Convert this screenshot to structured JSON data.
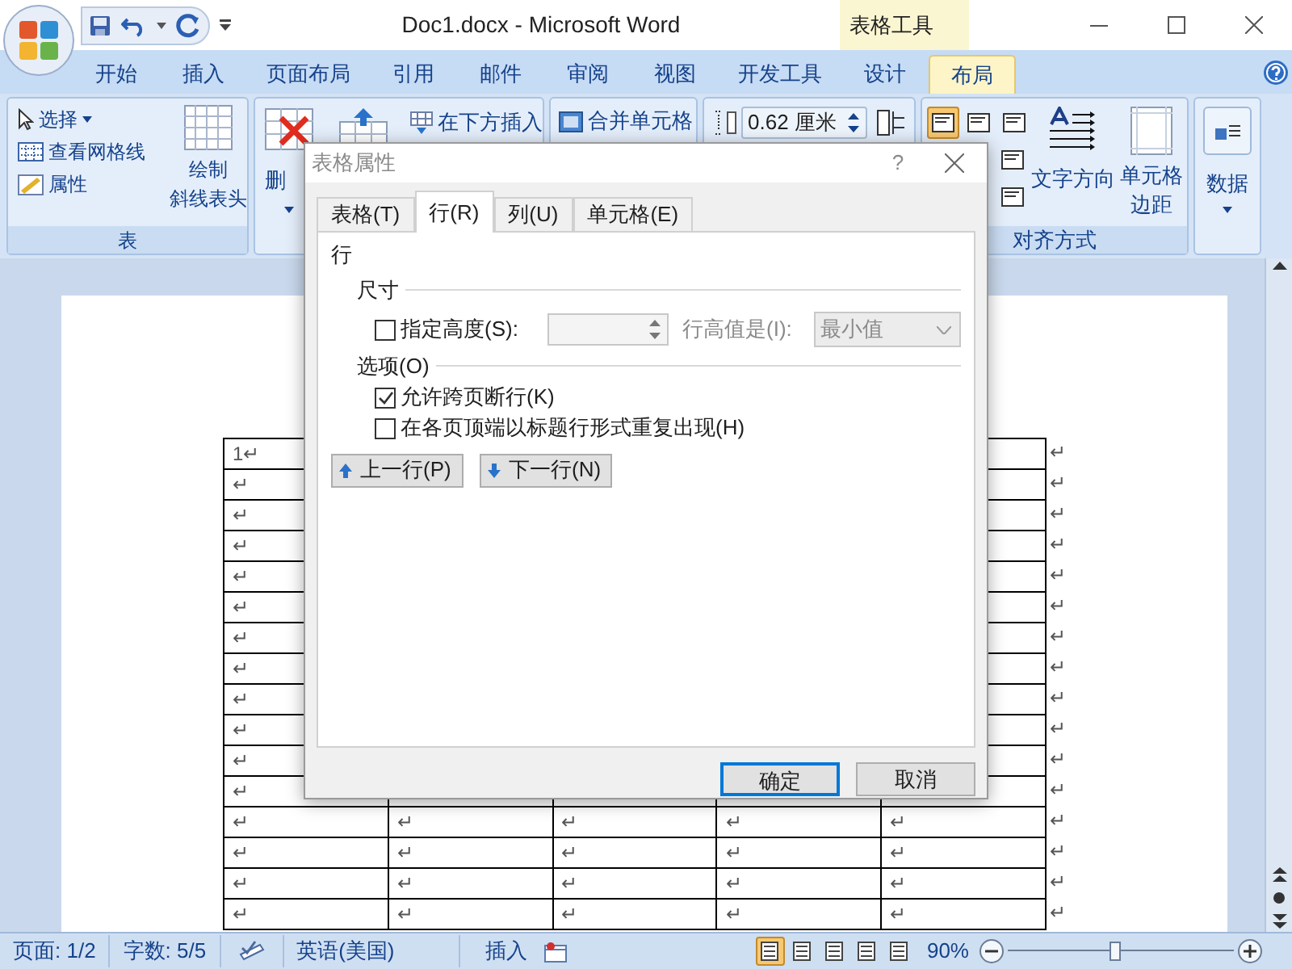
{
  "window": {
    "title": "Doc1.docx - Microsoft Word",
    "context_label": "表格工具"
  },
  "ribbon_tabs": [
    {
      "label": "开始",
      "selected": false
    },
    {
      "label": "插入",
      "selected": false
    },
    {
      "label": "页面布局",
      "selected": false
    },
    {
      "label": "引用",
      "selected": false
    },
    {
      "label": "邮件",
      "selected": false
    },
    {
      "label": "审阅",
      "selected": false
    },
    {
      "label": "视图",
      "selected": false
    },
    {
      "label": "开发工具",
      "selected": false
    },
    {
      "label": "设计",
      "selected": false
    },
    {
      "label": "布局",
      "selected": true
    }
  ],
  "ribbon": {
    "select": "选择",
    "gridlines": "查看网格线",
    "properties": "属性",
    "draw_diagonal": [
      "绘制",
      "斜线表头"
    ],
    "table_group_label": "表",
    "delete": "删",
    "insert_below": "在下方插入",
    "merge": "合并单元格",
    "height_value": "0.62 厘米",
    "align_buttons": [
      {
        "selected": true
      },
      {
        "selected": false
      },
      {
        "selected": false
      },
      {
        "selected": false
      },
      {
        "selected": false
      }
    ],
    "text_direction": "文字方向",
    "cell_margins": [
      "单元格",
      "边距"
    ],
    "alignment_group_label": "对齐方式",
    "data": "数据"
  },
  "document": {
    "rows": [
      {
        "cells": [
          "1↵"
        ],
        "end": "↵"
      },
      {
        "cells": [
          "↵"
        ],
        "end": "↵"
      },
      {
        "cells": [
          "↵"
        ],
        "end": "↵"
      },
      {
        "cells": [
          "↵"
        ],
        "end": "↵"
      },
      {
        "cells": [
          "↵"
        ],
        "end": "↵"
      },
      {
        "cells": [
          "↵"
        ],
        "end": "↵"
      },
      {
        "cells": [
          "↵"
        ],
        "end": "↵"
      },
      {
        "cells": [
          "↵"
        ],
        "end": "↵"
      },
      {
        "cells": [
          "↵"
        ],
        "end": "↵"
      },
      {
        "cells": [
          "↵"
        ],
        "end": "↵"
      },
      {
        "cells": [
          "↵"
        ],
        "end": "↵"
      },
      {
        "cells": [
          "↵"
        ],
        "end": "↵"
      },
      {
        "cells": [
          "↵",
          "↵",
          "↵",
          "↵",
          "↵"
        ],
        "end": "↵"
      },
      {
        "cells": [
          "↵",
          "↵",
          "↵",
          "↵",
          "↵"
        ],
        "end": "↵"
      },
      {
        "cells": [
          "↵",
          "↵",
          "↵",
          "↵",
          "↵"
        ],
        "end": "↵"
      },
      {
        "cells": [
          "↵",
          "↵",
          "↵",
          "↵",
          "↵"
        ],
        "end": "↵"
      }
    ]
  },
  "dialog": {
    "title": "表格属性",
    "help": "?",
    "tabs": [
      {
        "label": "表格(T)",
        "selected": false
      },
      {
        "label": "行(R)",
        "selected": true
      },
      {
        "label": "列(U)",
        "selected": false
      },
      {
        "label": "单元格(E)",
        "selected": false
      }
    ],
    "section": "行",
    "size_heading": "尺寸",
    "specify_height": {
      "label": "指定高度(S):",
      "checked": false
    },
    "height_field": {
      "disabled": true
    },
    "height_rule": {
      "label": "行高值是(I):",
      "value": "最小值",
      "disabled": true
    },
    "options_heading": "选项(O)",
    "options": [
      {
        "label": "允许跨页断行(K)",
        "checked": true
      },
      {
        "label": "在各页顶端以标题行形式重复出现(H)",
        "checked": false
      }
    ],
    "prev_row": "上一行(P)",
    "next_row": "下一行(N)",
    "ok": "确定",
    "cancel": "取消"
  },
  "status_bar": {
    "page": "页面: 1/2",
    "words": "字数: 5/5",
    "language": "英语(美国)",
    "mode": "插入",
    "views": [
      {
        "selected": true
      },
      {
        "selected": false
      },
      {
        "selected": false
      },
      {
        "selected": false
      },
      {
        "selected": false
      }
    ],
    "zoom": "90%",
    "zoom_slider": {
      "level": 0.47
    }
  }
}
